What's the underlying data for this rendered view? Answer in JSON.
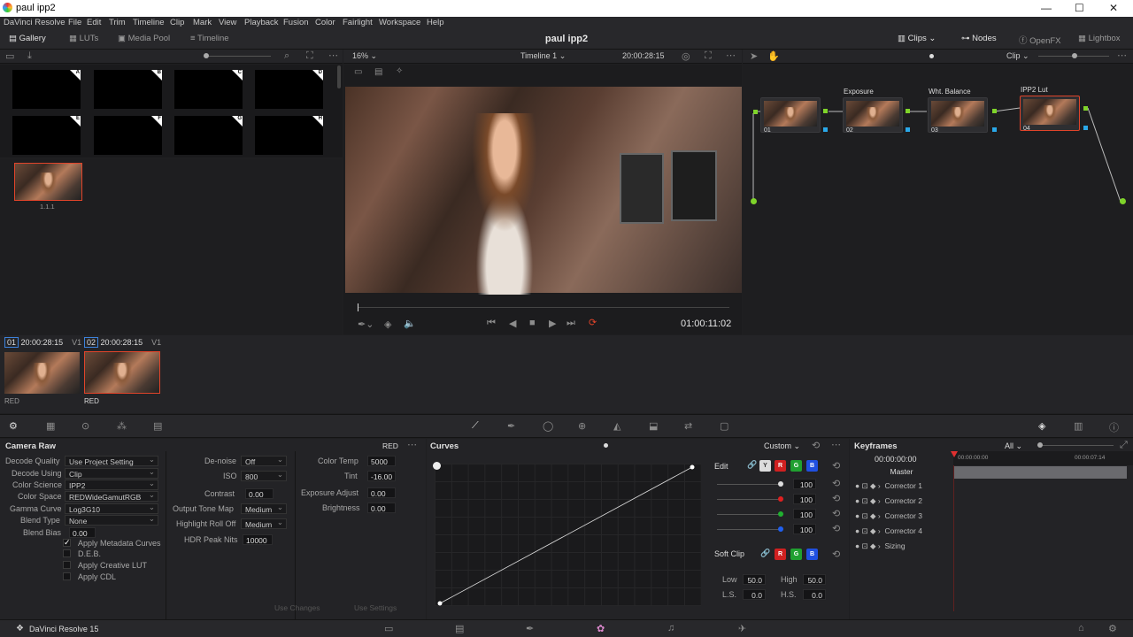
{
  "window": {
    "title": "paul ipp2",
    "minimize": "—",
    "maximize": "☐",
    "close": "✕"
  },
  "menu": [
    "DaVinci Resolve",
    "File",
    "Edit",
    "Trim",
    "Timeline",
    "Clip",
    "Mark",
    "View",
    "Playback",
    "Fusion",
    "Color",
    "Fairlight",
    "Workspace",
    "Help"
  ],
  "toolbar": {
    "gallery": "Gallery",
    "luts": "LUTs",
    "media_pool": "Media Pool",
    "timeline": "Timeline",
    "project_title": "paul ipp2",
    "clips": "Clips",
    "nodes": "Nodes",
    "openfx": "OpenFX",
    "lightbox": "Lightbox"
  },
  "viewer": {
    "zoom": "16%",
    "timeline_name": "Timeline 1",
    "timecode_top": "20:00:28:15",
    "timecode": "01:00:11:02",
    "clip_mode": "Clip"
  },
  "gallery": {
    "stills": [
      "A",
      "B",
      "C",
      "D",
      "E",
      "F",
      "G",
      "H"
    ],
    "grab_label": "1.1.1"
  },
  "clips": [
    {
      "num": "01",
      "tc": "20:00:28:15",
      "track": "V1",
      "codec": "RED"
    },
    {
      "num": "02",
      "tc": "20:00:28:15",
      "track": "V1",
      "codec": "RED"
    }
  ],
  "nodes": [
    {
      "num": "01",
      "label": ""
    },
    {
      "num": "02",
      "label": "Exposure"
    },
    {
      "num": "03",
      "label": "Wht. Balance"
    },
    {
      "num": "04",
      "label": "IPP2 Lut"
    }
  ],
  "camera_raw": {
    "title": "Camera Raw",
    "codec": "RED",
    "left": [
      {
        "label": "Decode Quality",
        "value": "Use Project Setting"
      },
      {
        "label": "Decode Using",
        "value": "Clip"
      },
      {
        "label": "Color Science",
        "value": "IPP2"
      },
      {
        "label": "Color Space",
        "value": "REDWideGamutRGB"
      },
      {
        "label": "Gamma Curve",
        "value": "Log3G10"
      },
      {
        "label": "Blend Type",
        "value": "None"
      }
    ],
    "blend_bias_label": "Blend Bias",
    "blend_bias": "0.00",
    "checks": [
      {
        "label": "Apply Metadata Curves",
        "checked": true
      },
      {
        "label": "D.E.B.",
        "checked": false
      },
      {
        "label": "Apply Creative LUT",
        "checked": false
      },
      {
        "label": "Apply CDL",
        "checked": false
      }
    ],
    "mid": [
      {
        "label": "De-noise",
        "value": "Off",
        "type": "dd"
      },
      {
        "label": "ISO",
        "value": "800",
        "type": "dd"
      },
      {
        "label": "Contrast",
        "value": "0.00",
        "type": "val"
      },
      {
        "label": "Output Tone Map",
        "value": "Medium",
        "type": "dd"
      },
      {
        "label": "Highlight Roll Off",
        "value": "Medium",
        "type": "dd"
      },
      {
        "label": "HDR Peak Nits",
        "value": "10000",
        "type": "val"
      }
    ],
    "right": [
      {
        "label": "Color Temp",
        "value": "5000"
      },
      {
        "label": "Tint",
        "value": "-16.00"
      },
      {
        "label": "Exposure Adjust",
        "value": "0.00"
      },
      {
        "label": "Brightness",
        "value": "0.00"
      }
    ],
    "use_changes": "Use Changes",
    "use_settings": "Use Settings"
  },
  "curves": {
    "title": "Curves",
    "mode": "Custom",
    "edit": "Edit",
    "channels": [
      "Y",
      "R",
      "G",
      "B"
    ],
    "intensity": [
      "100",
      "100",
      "100",
      "100"
    ],
    "soft_clip": "Soft Clip",
    "low_label": "Low",
    "low": "50.0",
    "high_label": "High",
    "high": "50.0",
    "ls_label": "L.S.",
    "ls": "0.0",
    "hs_label": "H.S.",
    "hs": "0.0"
  },
  "keyframes": {
    "title": "Keyframes",
    "filter": "All",
    "tc": "00:00:00:00",
    "ruler_start": "00:00:00:00",
    "ruler_end": "00:00:07:14",
    "rows": [
      "Master",
      "Corrector 1",
      "Corrector 2",
      "Corrector 3",
      "Corrector 4",
      "Sizing"
    ]
  },
  "status": {
    "app": "DaVinci Resolve 15"
  }
}
